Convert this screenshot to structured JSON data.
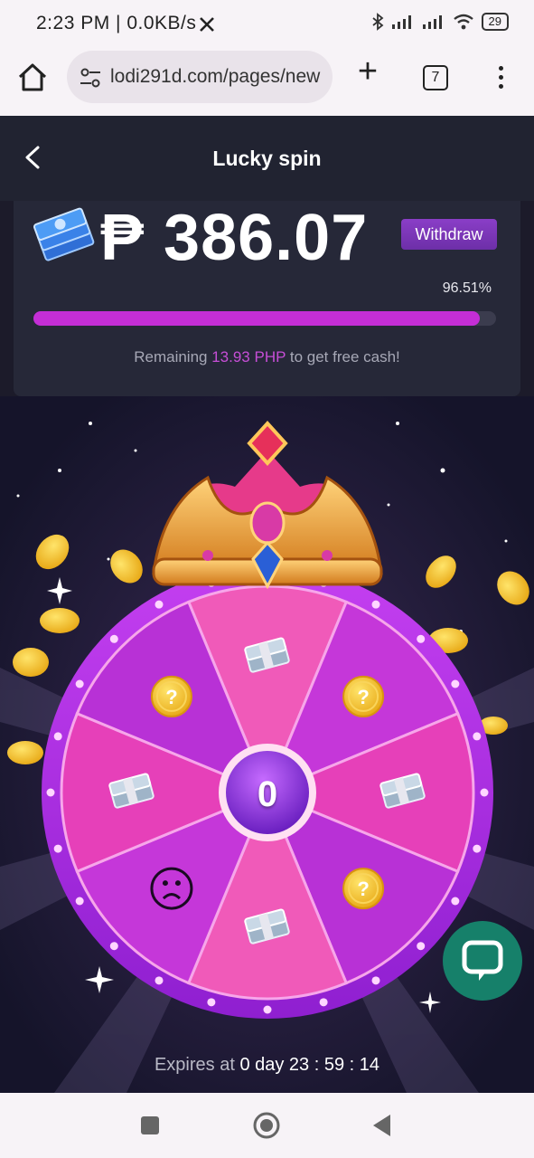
{
  "status_bar": {
    "time": "2:23 PM | 0.0KB/s",
    "x_icon": "x-logo-icon",
    "battery": "29"
  },
  "browser": {
    "url": "lodi291d.com/pages/new",
    "tab_count": "7",
    "new_tab_label": "+"
  },
  "header": {
    "title": "Lucky spin"
  },
  "balance": {
    "amount": "₱ 386.07",
    "withdraw_label": "Withdraw",
    "progress_percent": "96.51%",
    "progress_value": 0.9651,
    "remaining_prefix": "Remaining ",
    "remaining_amount": "13.93 PHP",
    "remaining_suffix": " to get free cash!"
  },
  "wheel": {
    "center_value": "0",
    "segments": [
      "money-stack",
      "coin-question",
      "money-stack",
      "coin-question",
      "money-stack",
      "sad-face",
      "money-stack",
      "coin-question"
    ]
  },
  "expires": {
    "prefix": "Expires at ",
    "value": "0 day 23 : 59 : 14"
  },
  "colors": {
    "accent": "#c42ed6",
    "withdraw": "#7b36b8",
    "chat": "#16806a"
  }
}
